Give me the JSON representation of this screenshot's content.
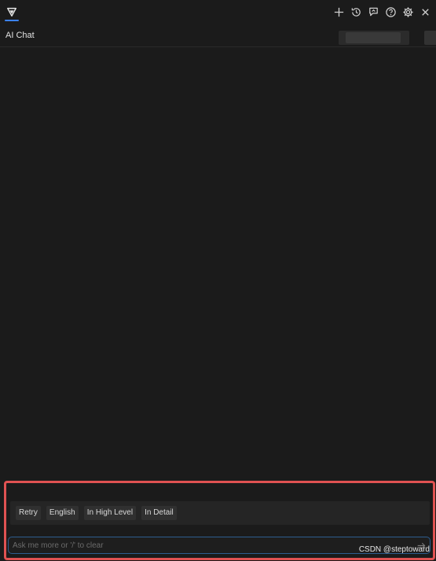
{
  "toolbar": {
    "logo": "app-logo-icon",
    "icons": [
      "plus-icon",
      "history-icon",
      "feedback-icon",
      "help-icon",
      "gear-icon",
      "close-icon"
    ]
  },
  "tab": {
    "title": "AI Chat"
  },
  "suggestions": [
    "Retry",
    "English",
    "In High Level",
    "In Detail"
  ],
  "input": {
    "placeholder": "Ask me more or '/' to clear",
    "value": ""
  },
  "watermark": "CSDN @steptoward",
  "colors": {
    "background": "#1b1b1b",
    "accent": "#3b82f6",
    "highlight_border": "#e05252",
    "input_border": "#2d5d8f"
  }
}
